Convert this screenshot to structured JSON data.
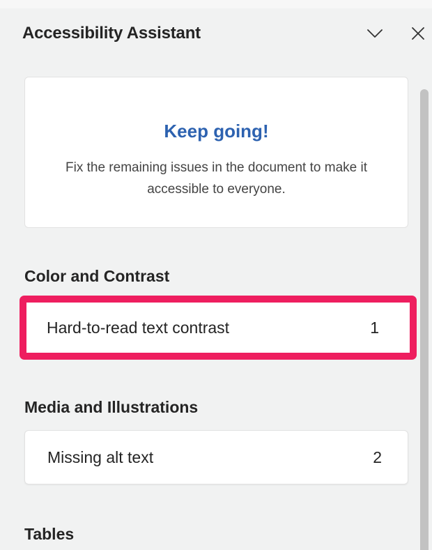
{
  "pane": {
    "title": "Accessibility Assistant",
    "collapse_icon": "chevron-down-icon",
    "close_icon": "close-icon"
  },
  "status_card": {
    "title": "Keep going!",
    "message": "Fix the remaining issues in the document to make it accessible to everyone."
  },
  "sections": [
    {
      "heading": "Color and Contrast",
      "issues": [
        {
          "label": "Hard-to-read text contrast",
          "count": "1",
          "highlighted": true
        }
      ]
    },
    {
      "heading": "Media and Illustrations",
      "issues": [
        {
          "label": "Missing alt text",
          "count": "2",
          "highlighted": false
        }
      ]
    },
    {
      "heading": "Tables",
      "issues": []
    }
  ],
  "colors": {
    "accent_title": "#2d62b0",
    "highlight_border": "#ee1e5f",
    "pane_background": "#f1f2f2",
    "card_background": "#ffffff"
  }
}
